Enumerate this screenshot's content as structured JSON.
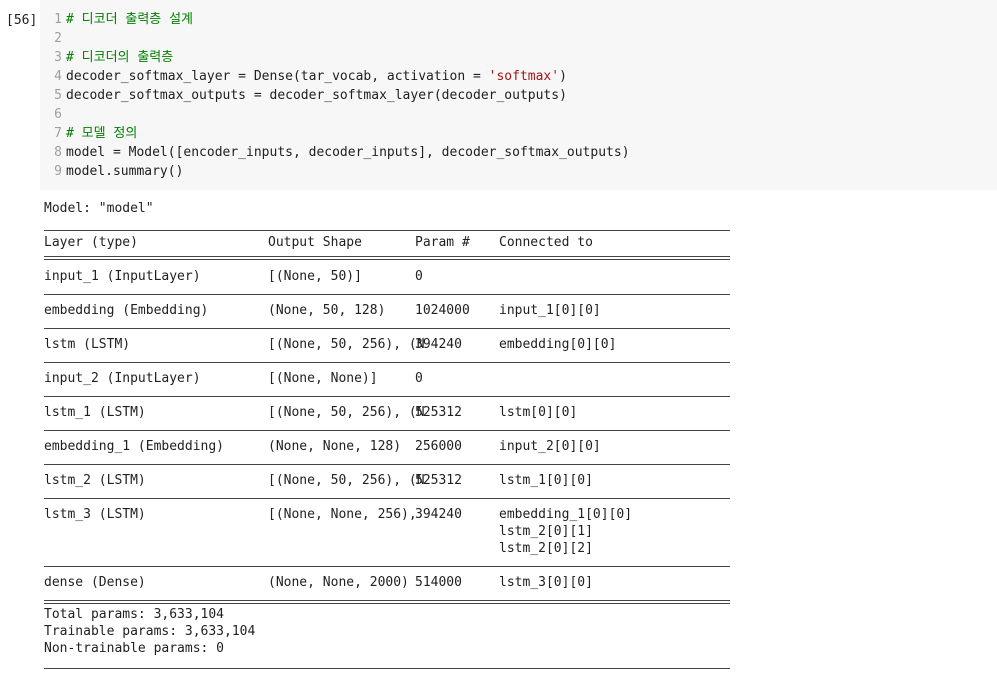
{
  "cell": {
    "execution_count": "[56]",
    "code_lines": [
      {
        "n": "1",
        "type": "comment",
        "text": "# 디코더 출력층 설계"
      },
      {
        "n": "2",
        "type": "code",
        "text": ""
      },
      {
        "n": "3",
        "type": "comment",
        "text": "# 디코더의 출력층"
      },
      {
        "n": "4",
        "type": "code_str",
        "pre": "decoder_softmax_layer = Dense(tar_vocab, activation = ",
        "str": "'softmax'",
        "post": ")"
      },
      {
        "n": "5",
        "type": "code",
        "text": "decoder_softmax_outputs = decoder_softmax_layer(decoder_outputs)"
      },
      {
        "n": "6",
        "type": "code",
        "text": ""
      },
      {
        "n": "7",
        "type": "comment",
        "text": "# 모델 정의"
      },
      {
        "n": "8",
        "type": "code",
        "text": "model = Model([encoder_inputs, decoder_inputs], decoder_softmax_outputs)"
      },
      {
        "n": "9",
        "type": "code",
        "text": "model.summary()"
      }
    ]
  },
  "output": {
    "model_title": "Model: \"model\"",
    "headers": {
      "layer": "Layer (type)",
      "shape": "Output Shape",
      "params": "Param #",
      "connected": "Connected to"
    },
    "rows": [
      {
        "layer": "input_1 (InputLayer)",
        "shape": "[(None, 50)]",
        "params": "0",
        "connected": [
          ""
        ]
      },
      {
        "layer": "embedding (Embedding)",
        "shape": "(None, 50, 128)",
        "params": "1024000",
        "connected": [
          "input_1[0][0]"
        ]
      },
      {
        "layer": "lstm (LSTM)",
        "shape": "[(None, 50, 256), (N",
        "params": "394240",
        "connected": [
          "embedding[0][0]"
        ]
      },
      {
        "layer": "input_2 (InputLayer)",
        "shape": "[(None, None)]",
        "params": "0",
        "connected": [
          ""
        ]
      },
      {
        "layer": "lstm_1 (LSTM)",
        "shape": "[(None, 50, 256), (N",
        "params": "525312",
        "connected": [
          "lstm[0][0]"
        ]
      },
      {
        "layer": "embedding_1 (Embedding)",
        "shape": "(None, None, 128)",
        "params": "256000",
        "connected": [
          "input_2[0][0]"
        ]
      },
      {
        "layer": "lstm_2 (LSTM)",
        "shape": "[(None, 50, 256), (N",
        "params": "525312",
        "connected": [
          "lstm_1[0][0]"
        ]
      },
      {
        "layer": "lstm_3 (LSTM)",
        "shape": "[(None, None, 256),",
        "params": "394240",
        "connected": [
          "embedding_1[0][0]",
          "lstm_2[0][1]",
          "lstm_2[0][2]"
        ]
      },
      {
        "layer": "dense (Dense)",
        "shape": "(None, None, 2000)",
        "params": "514000",
        "connected": [
          "lstm_3[0][0]"
        ]
      }
    ],
    "totals": {
      "total": "Total params: 3,633,104",
      "trainable": "Trainable params: 3,633,104",
      "non_trainable": "Non-trainable params: 0"
    }
  }
}
